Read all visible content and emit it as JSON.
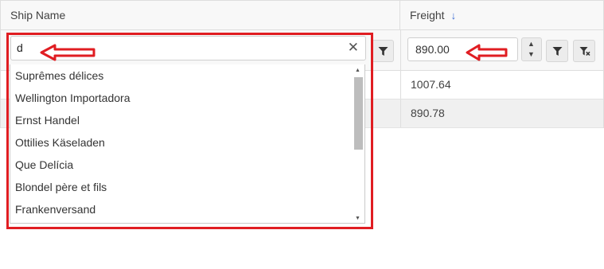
{
  "header": {
    "ship_name_label": "Ship Name",
    "freight_label": "Freight",
    "freight_sort_icon": "arrow-down-icon"
  },
  "filters": {
    "ship_name": {
      "value": "d",
      "clear_icon": "close-icon",
      "filter_button_icon": "filter-icon"
    },
    "freight": {
      "value": "890.00",
      "spinner_up_icon": "triangle-up-icon",
      "spinner_down_icon": "triangle-down-icon",
      "filter_button_icon": "filter-icon",
      "clear_filter_button_icon": "filter-clear-icon"
    }
  },
  "dropdown": {
    "items": [
      "Suprêmes délices",
      "Wellington Importadora",
      "Ernst Handel",
      "Ottilies Käseladen",
      "Que Delícia",
      "Blondel père et fils",
      "Frankenversand"
    ],
    "scrollbar_position": 0.0
  },
  "rows": [
    {
      "freight": "1007.64"
    },
    {
      "freight": "890.78"
    }
  ],
  "annotations": {
    "highlight_color": "#e01d22",
    "arrow_icon": "arrow-left-icon"
  }
}
